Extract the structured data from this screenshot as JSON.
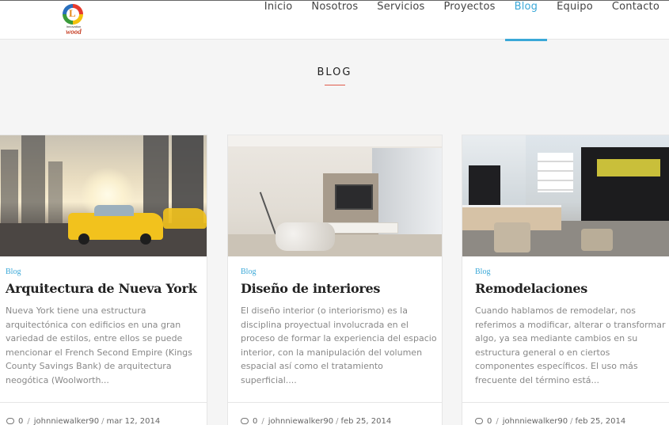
{
  "brand": {
    "tagline": "Innovation",
    "wordmark": "wood",
    "logo_letter": "L"
  },
  "nav": {
    "items": [
      {
        "label": "Inicio",
        "active": false
      },
      {
        "label": "Nosotros",
        "active": false
      },
      {
        "label": "Servicios",
        "active": false
      },
      {
        "label": "Proyectos",
        "active": false
      },
      {
        "label": "Blog",
        "active": true
      },
      {
        "label": "Equipo",
        "active": false
      },
      {
        "label": "Contacto",
        "active": false
      }
    ]
  },
  "section": {
    "title": "BLOG"
  },
  "posts": [
    {
      "category": "Blog",
      "title": "Arquitectura de Nueva York",
      "excerpt": "Nueva York tiene una estructura arquitectónica con edificios en una gran variedad de estilos, entre ellos se puede mencionar el French Second Empire (Kings County Savings Bank) de arquitectura neogótica (Woolworth...",
      "comments": "0",
      "author": "johnniewalker90",
      "date": "mar 12, 2014"
    },
    {
      "category": "Blog",
      "title": "Diseño de interiores",
      "excerpt": "El diseño interior (o interiorismo) es la disciplina proyectual involucrada en el proceso de formar la experiencia del espacio interior, con la manipulación del volumen espacial así como el tratamiento superficial....",
      "comments": "0",
      "author": "johnniewalker90",
      "date": "feb 25, 2014"
    },
    {
      "category": "Blog",
      "title": "Remodelaciones",
      "excerpt": "Cuando hablamos de remodelar, nos referimos a modificar, alterar o transformar algo, ya sea mediante cambios en su estructura general o en ciertos componentes específicos. El uso más frecuente del término está...",
      "comments": "0",
      "author": "johnniewalker90",
      "date": "feb 25, 2014"
    }
  ],
  "colors": {
    "accent": "#3aa8d8",
    "title_rule": "#e05b4b"
  },
  "icons": {
    "comment": "comment-icon"
  }
}
